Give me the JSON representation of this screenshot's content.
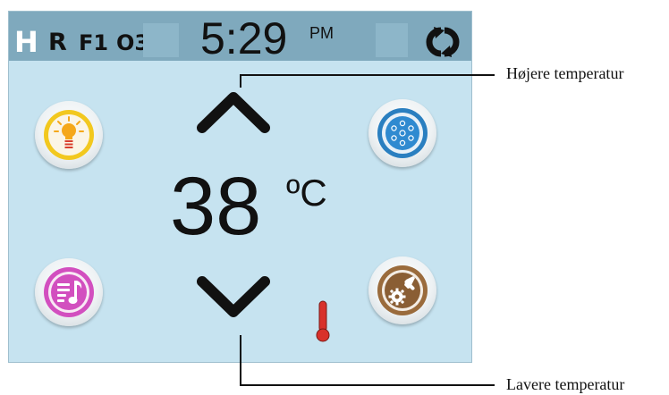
{
  "status_bar": {
    "indicators": [
      "H",
      "R",
      "F1",
      "O3"
    ],
    "time": "5:29",
    "ampm": "PM",
    "sync_icon": "sync-icon"
  },
  "temperature": {
    "value": "38",
    "unit": "ºC"
  },
  "buttons": {
    "light": "light-bulb-icon",
    "jets": "jets-icon",
    "music": "music-icon",
    "settings": "settings-icon"
  },
  "callouts": {
    "up": "Højere temperatur",
    "down": "Lavere temperatur"
  },
  "colors": {
    "screen_bg": "#c6e3f0",
    "status_bar": "#7fa9bd",
    "light_ring": "#f2c81f",
    "jets_ring": "#2a7fc0",
    "music_ring": "#d24fbf",
    "settings_ring": "#9a6b3c",
    "thermometer": "#d8312b"
  }
}
